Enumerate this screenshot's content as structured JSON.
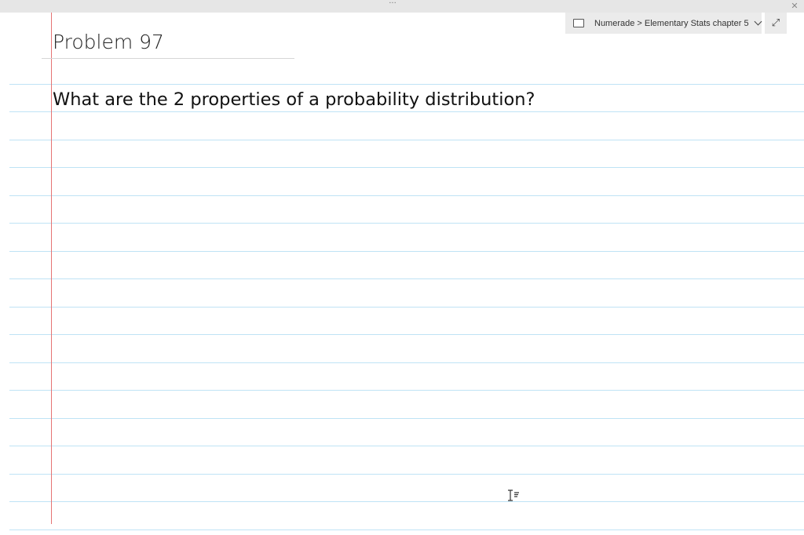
{
  "titlebar": {
    "more_icon": "more-horizontal-icon",
    "more_glyph": "···",
    "close_icon": "close-icon",
    "close_glyph": "✕"
  },
  "breadcrumb": {
    "notebook_icon": "notebook-icon",
    "path": "Numerade > Elementary Stats chapter 5",
    "chevron_icon": "chevron-down-icon"
  },
  "expand": {
    "icon": "expand-icon",
    "glyph": "⤢"
  },
  "page": {
    "title": "Problem 97",
    "question": "What are the 2 properties of a probability distribution?"
  },
  "cursor": {
    "icon": "text-cursor-icon"
  },
  "colors": {
    "rule_line": "#bfe3f5",
    "margin_line": "#e57373",
    "titlebar": "#e6e6e6",
    "toolbar_button": "#ebebeb"
  }
}
